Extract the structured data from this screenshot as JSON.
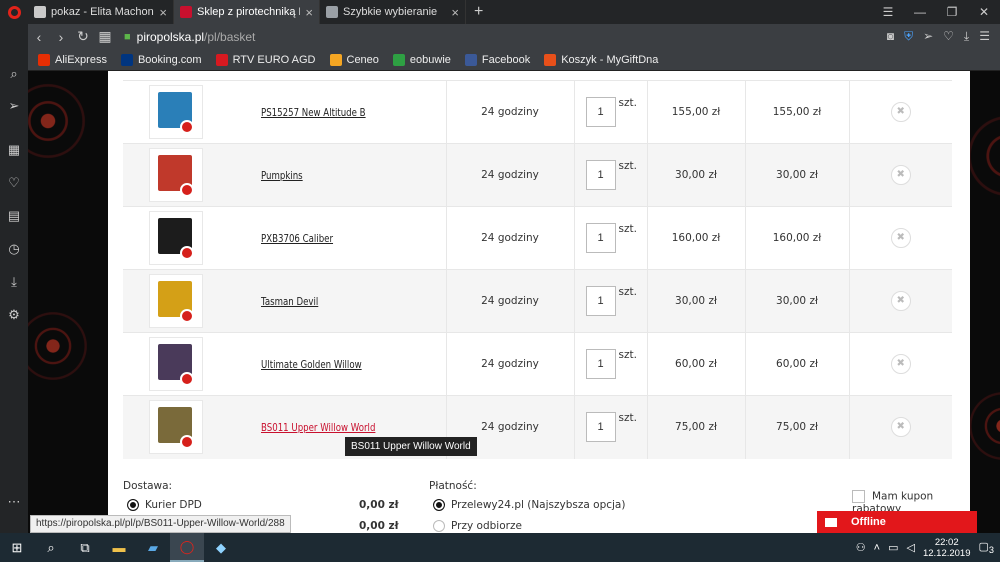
{
  "browser": {
    "tabs": [
      {
        "title": "pokaz - Elita Machonego",
        "active": false,
        "favicon_color": "#c9c9c9"
      },
      {
        "title": "Sklep z pirotechniką PiroPo",
        "active": true,
        "favicon_color": "#c8102e"
      },
      {
        "title": "Szybkie wybieranie",
        "active": false,
        "favicon_color": "#9aa0a6"
      }
    ],
    "new_tab": "+",
    "close_glyph": "×",
    "url_host": "piropolska.pl",
    "url_path": "/pl/basket",
    "bookmarks": [
      {
        "label": "AliExpress",
        "color": "#e62e04"
      },
      {
        "label": "Booking.com",
        "color": "#003580"
      },
      {
        "label": "RTV EURO AGD",
        "color": "#d71920"
      },
      {
        "label": "Ceneo",
        "color": "#f5a623"
      },
      {
        "label": "eobuwie",
        "color": "#2ea043"
      },
      {
        "label": "Facebook",
        "color": "#3b5998"
      },
      {
        "label": "Koszyk - MyGiftDna",
        "color": "#e8501a"
      }
    ]
  },
  "basket": {
    "rows": [
      {
        "name": "PS15257 New Altitude B",
        "time": "24 godziny",
        "qty": "1",
        "unit": "szt.",
        "price": "155,00 zł",
        "total": "155,00 zł",
        "box_color": "#2a7fb8"
      },
      {
        "name": "Pumpkins",
        "time": "24 godziny",
        "qty": "1",
        "unit": "szt.",
        "price": "30,00 zł",
        "total": "30,00 zł",
        "box_color": "#c0392b"
      },
      {
        "name": "PXB3706 Caliber",
        "time": "24 godziny",
        "qty": "1",
        "unit": "szt.",
        "price": "160,00 zł",
        "total": "160,00 zł",
        "box_color": "#1c1c1c"
      },
      {
        "name": "Tasman Devil",
        "time": "24 godziny",
        "qty": "1",
        "unit": "szt.",
        "price": "30,00 zł",
        "total": "30,00 zł",
        "box_color": "#d4a017"
      },
      {
        "name": "Ultimate Golden Willow",
        "time": "24 godziny",
        "qty": "1",
        "unit": "szt.",
        "price": "60,00 zł",
        "total": "60,00 zł",
        "box_color": "#4a3a5a"
      },
      {
        "name": "BS011 Upper Willow World",
        "time": "24 godziny",
        "qty": "1",
        "unit": "szt.",
        "price": "75,00 zł",
        "total": "75,00 zł",
        "box_color": "#7a6a3a"
      }
    ],
    "tooltip": "BS011 Upper Willow World"
  },
  "delivery": {
    "label": "Dostawa:",
    "options": [
      {
        "label": "Kurier DPD",
        "price": "0,00 zł",
        "selected": true
      },
      {
        "label": "",
        "price": "0,00 zł",
        "selected": false
      }
    ]
  },
  "payment": {
    "label": "Płatność:",
    "options": [
      {
        "label": "Przelewy24.pl (Najszybsza opcja)",
        "selected": true
      },
      {
        "label": "Przy odbiorze",
        "selected": false
      }
    ]
  },
  "coupon_label": "Mam kupon rabatowy",
  "chat": {
    "label": "Offline"
  },
  "status_url": "https://piropolska.pl/pl/p/BS011-Upper-Willow-World/288",
  "taskbar": {
    "time": "22:02",
    "date": "12.12.2019",
    "notifications": "3"
  }
}
